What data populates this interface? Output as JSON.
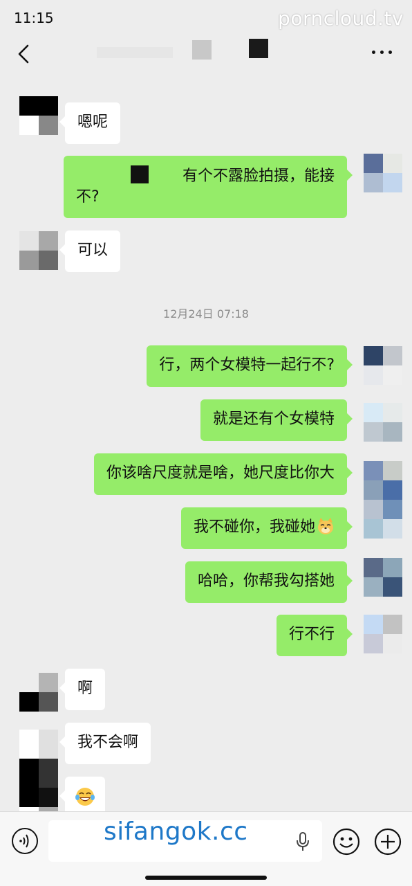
{
  "status_bar": {
    "time": "11:15",
    "watermark": "porncloud.tv"
  },
  "nav": {
    "back_icon": "chevron-left-icon",
    "more_icon": "more-dots-icon"
  },
  "chat": {
    "timestamp": "12月24日 07:18",
    "messages": [
      {
        "dir": "in",
        "text": "嗯呢"
      },
      {
        "dir": "out",
        "text_line1": "有个不露脸拍摄，能接",
        "text_line2": "不?"
      },
      {
        "dir": "in",
        "text": "可以"
      },
      {
        "dir": "out",
        "text": "行，两个女模特一起行不?"
      },
      {
        "dir": "out",
        "text": "就是还有个女模特"
      },
      {
        "dir": "out",
        "text": "你该啥尺度就是啥，她尺度比你大"
      },
      {
        "dir": "out",
        "text": "我不碰你，我碰她",
        "emoji": "doge-cat-emoji"
      },
      {
        "dir": "out",
        "text": "哈哈，你帮我勾搭她"
      },
      {
        "dir": "out",
        "text": "行不行"
      },
      {
        "dir": "in",
        "text": "啊"
      },
      {
        "dir": "in",
        "text": "我不会啊"
      },
      {
        "dir": "in",
        "text": "",
        "emoji": "laughing-tears-emoji"
      }
    ]
  },
  "input_bar": {
    "watermark": "sifangok.cc",
    "voice_icon": "voice-icon",
    "mic_icon": "mic-icon",
    "emoji_icon": "smiley-icon",
    "plus_icon": "plus-icon"
  },
  "colors": {
    "background": "#ededed",
    "bubble_out": "#95ec69",
    "bubble_in": "#ffffff",
    "watermark_bottom": "#1e78c8"
  }
}
